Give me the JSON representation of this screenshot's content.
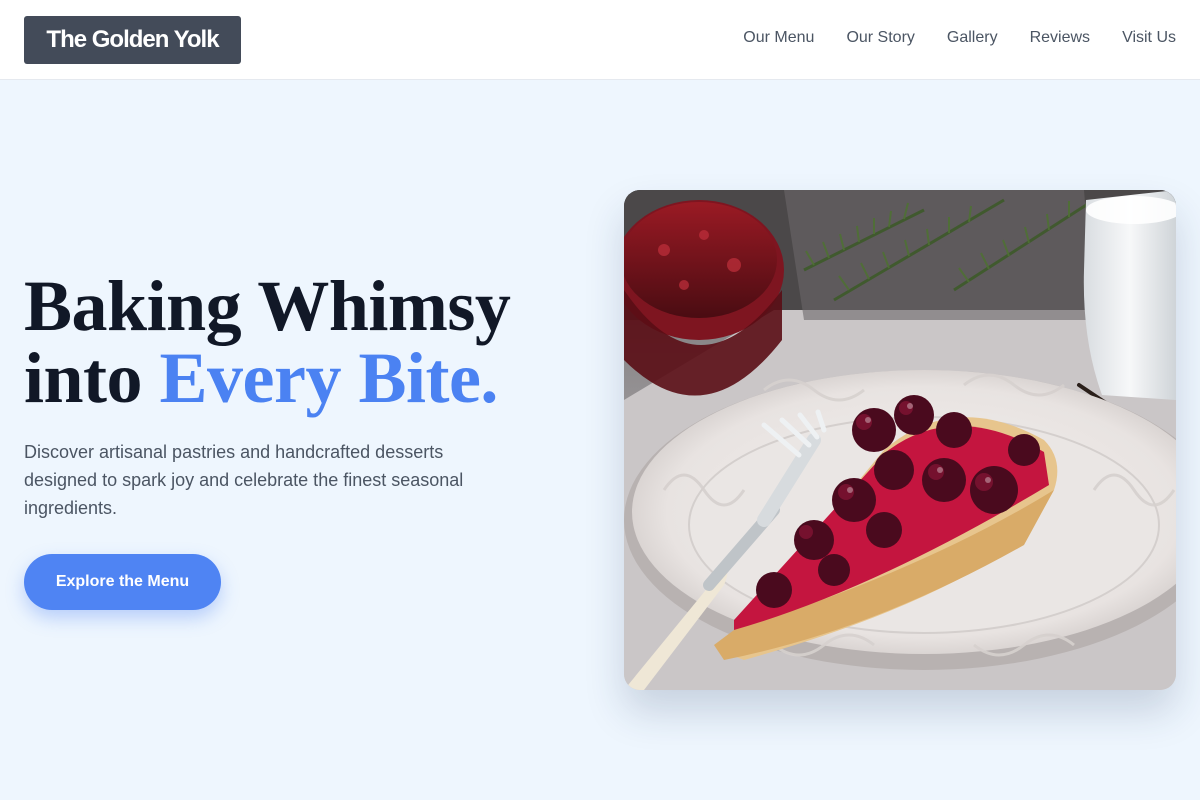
{
  "header": {
    "brand": "The Golden Yolk",
    "nav": [
      "Our Menu",
      "Our Story",
      "Gallery",
      "Reviews",
      "Visit Us"
    ]
  },
  "hero": {
    "headline_line1": "Baking Whimsy",
    "headline_line2_prefix": "into ",
    "headline_line2_accent": "Every Bite.",
    "description": "Discover artisanal pastries and handcrafted desserts designed to spark joy and celebrate the finest seasonal ingredients.",
    "cta_label": "Explore the Menu",
    "image_subject": "slice of cherry tart on a white plate with a fork"
  },
  "colors": {
    "page_background": "#eef6fe",
    "brand_box": "#434b59",
    "accent": "#4b82f2",
    "button": "#4f84f3",
    "heading": "#111827",
    "body_text": "#4b5563"
  }
}
